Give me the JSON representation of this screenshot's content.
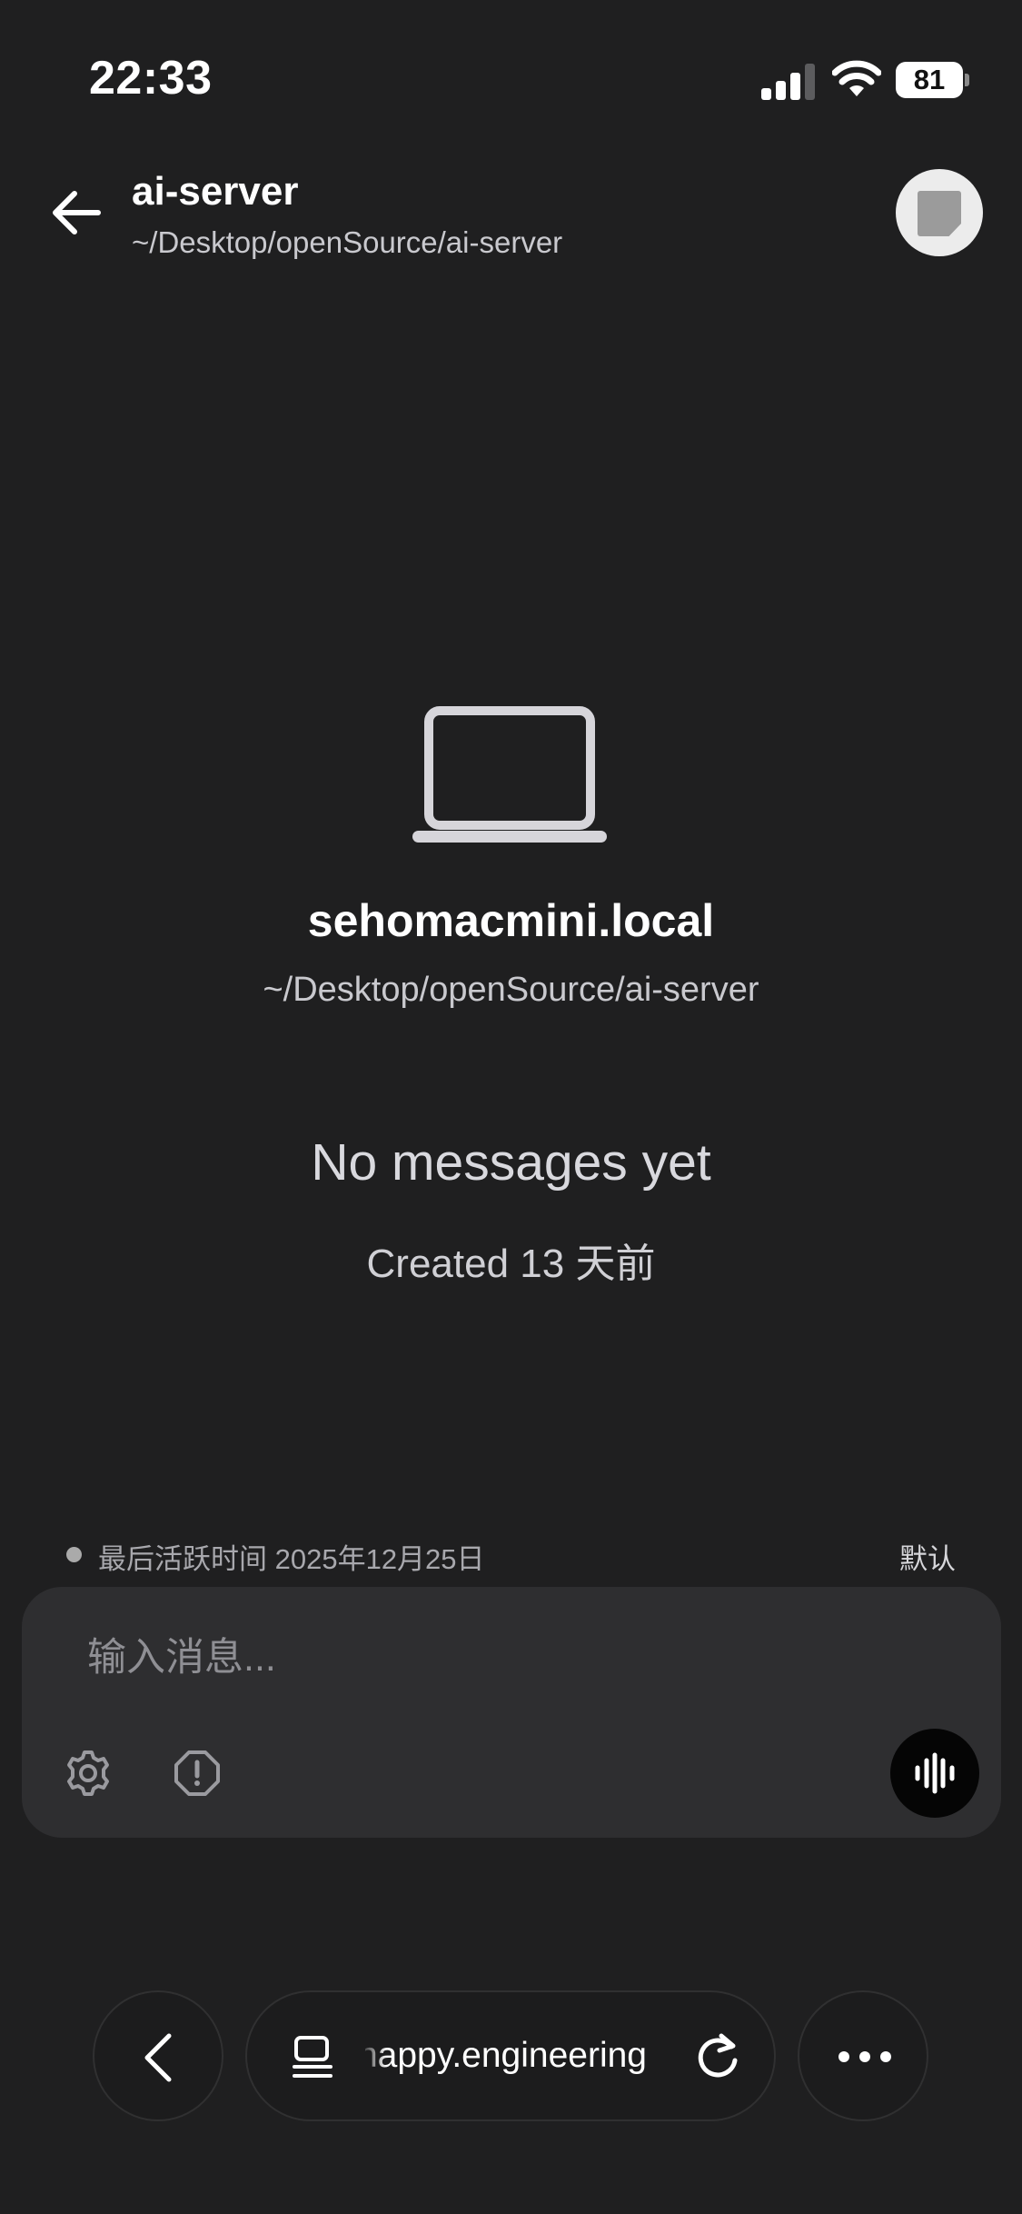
{
  "status_bar": {
    "time": "22:33",
    "battery_percent": "81",
    "signal_bars": 4,
    "wifi": true
  },
  "header": {
    "title": "ai-server",
    "path": "~/Desktop/openSource/ai-server",
    "back_icon": "arrow-left-icon",
    "avatar_icon": "note-square-icon"
  },
  "session": {
    "device_icon": "laptop-icon",
    "machine_name": "sehomacmini.local",
    "path": "~/Desktop/openSource/ai-server",
    "empty_title": "No messages yet",
    "created": "Created 13 天前"
  },
  "activity": {
    "last_active": "最后活跃时间 2025年12月25日",
    "mode": "默认"
  },
  "composer": {
    "placeholder": "输入消息...",
    "value": "",
    "icons": [
      "gear-icon",
      "alert-circle-icon",
      "voice-waveform-icon"
    ]
  },
  "browser_bar": {
    "url": "happy.engineering",
    "icons": [
      "chevron-left-icon",
      "tabs-icon",
      "reload-icon",
      "more-dots-icon"
    ]
  },
  "colors": {
    "background": "#1f1f20",
    "composer_background": "#2e2e30",
    "voice_button": "#050505",
    "primary_text": "#ffffff",
    "secondary_text": "#c9c9ce"
  }
}
